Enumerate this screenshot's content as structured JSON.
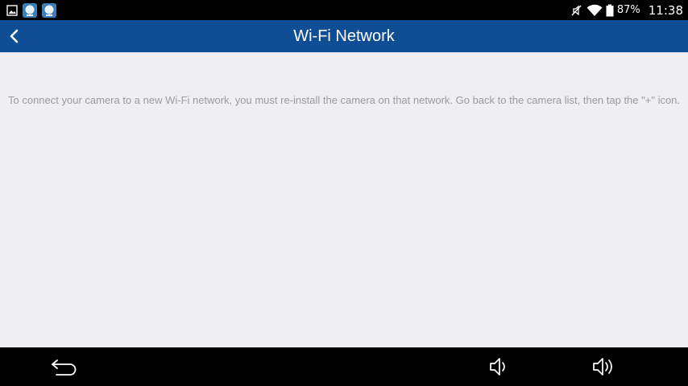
{
  "status_bar": {
    "battery_percent": "87%",
    "time": "11:38",
    "icons": [
      "gallery-icon",
      "app-notification-icon",
      "app-notification-icon",
      "mute-icon",
      "wifi-icon",
      "battery-icon"
    ]
  },
  "app_bar": {
    "title": "Wi-Fi Network",
    "back_icon": "chevron-left-icon",
    "color": "#0f4e94"
  },
  "content": {
    "message": "To connect your camera to a new Wi-Fi network, you must re-install the camera on that network. Go back to the camera list, then tap the \"+\" icon."
  },
  "nav_bar": {
    "icons": [
      "back-arrow-icon",
      "volume-down-icon",
      "volume-up-icon"
    ]
  }
}
